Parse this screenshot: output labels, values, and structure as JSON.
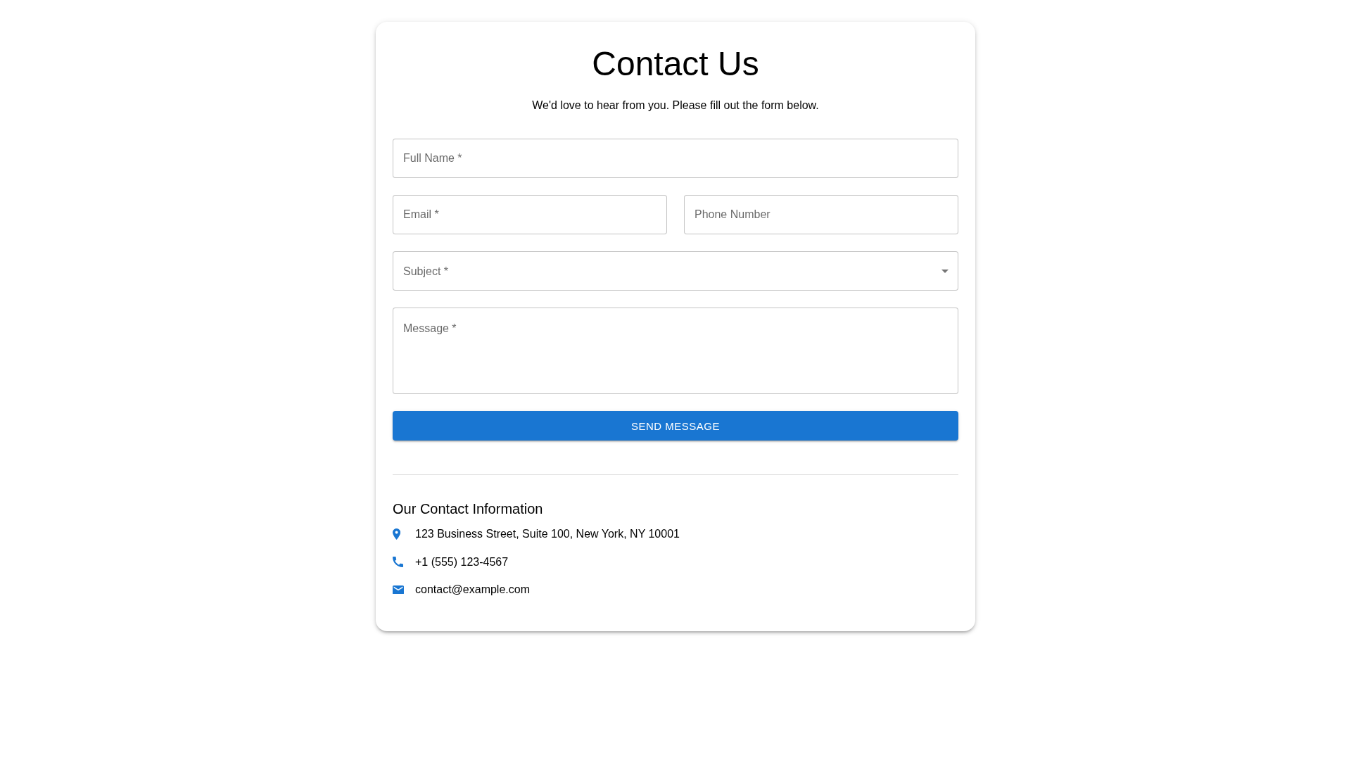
{
  "header": {
    "title": "Contact Us",
    "subtitle": "We'd love to hear from you. Please fill out the form below."
  },
  "form": {
    "rows": [
      {
        "fields": [
          {
            "kind": "text",
            "placeholder": "Full Name *"
          }
        ]
      },
      {
        "fields": [
          {
            "kind": "text",
            "placeholder": "Email *"
          },
          {
            "kind": "text",
            "placeholder": "Phone Number"
          }
        ]
      },
      {
        "fields": [
          {
            "kind": "select",
            "placeholder": "Subject *"
          }
        ]
      },
      {
        "fields": [
          {
            "kind": "textarea",
            "placeholder": "Message *"
          }
        ]
      }
    ],
    "submit_button": {
      "label": "SEND MESSAGE"
    }
  },
  "contact_info": {
    "heading": "Our Contact Information",
    "items": [
      {
        "kind": "address",
        "text": "123 Business Street, Suite 100, New York, NY 10001"
      },
      {
        "kind": "phone",
        "text": "+1 (555) 123-4567"
      },
      {
        "kind": "email",
        "text": "contact@example.com"
      }
    ]
  }
}
